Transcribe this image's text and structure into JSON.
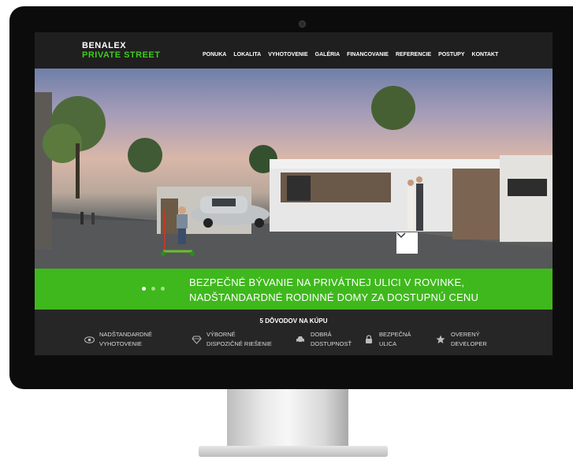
{
  "logo": {
    "line1": "BENALEX",
    "line2": "PRIVATE STREET"
  },
  "nav": [
    "PONUKA",
    "LOKALITA",
    "VYHOTOVENIE",
    "GALÉRIA",
    "FINANCOVANIE",
    "REFERENCIE",
    "POSTUPY",
    "KONTAKT"
  ],
  "hero": {
    "line1": "BEZPEČNÉ BÝVANIE NA PRIVÁTNEJ ULICI V ROVINKE,",
    "line2": "NADŠTANDARDNÉ RODINNÉ DOMY ZA DOSTUPNÚ CENU",
    "slides_total": 3,
    "active_slide": 1
  },
  "reasons": {
    "title": "5 DÔVODOV NA KÚPU",
    "items": [
      {
        "icon": "eye-icon",
        "line1": "NADŠTANDARDNÉ",
        "line2": "VYHOTOVENIE"
      },
      {
        "icon": "diamond-icon",
        "line1": "VÝBORNÉ",
        "line2": "DISPOZIČNÉ RIEŠENIE"
      },
      {
        "icon": "car-icon",
        "line1": "DOBRÁ",
        "line2": "DOSTUPNOSŤ"
      },
      {
        "icon": "lock-icon",
        "line1": "BEZPEČNÁ",
        "line2": "ULICA"
      },
      {
        "icon": "star-icon",
        "line1": "OVERENÝ",
        "line2": "DEVELOPER"
      }
    ]
  },
  "colors": {
    "accent": "#3fb81d",
    "header_bg": "#1f1f1f",
    "reasons_bg": "#262626"
  }
}
